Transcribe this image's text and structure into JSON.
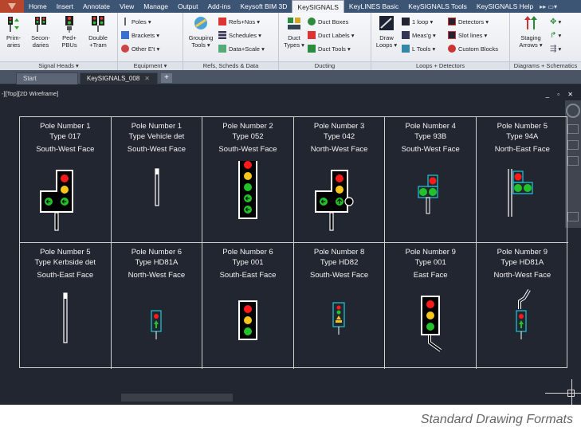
{
  "menubar": {
    "tabs": [
      "Home",
      "Insert",
      "Annotate",
      "View",
      "Manage",
      "Output",
      "Add-ins",
      "Keysoft BIM 3D",
      "KeySIGNALS",
      "KeyLINES Basic",
      "KeySIGNALS Tools",
      "KeySIGNALS Help"
    ],
    "active_tab": "KeySIGNALS"
  },
  "ribbon": {
    "signal_heads": {
      "label": "Signal Heads",
      "buttons": [
        {
          "line1": "Prim-",
          "line2": "aries"
        },
        {
          "line1": "Secon-",
          "line2": "daries"
        },
        {
          "line1": "Ped+",
          "line2": "PBUs"
        },
        {
          "line1": "Double",
          "line2": "+Tram"
        }
      ]
    },
    "equipment": {
      "label": "Equipment",
      "buttons": [
        "Poles",
        "Brackets",
        "Other E't"
      ]
    },
    "refs": {
      "label": "Refs, Scheds & Data",
      "big": {
        "line1": "Grouping",
        "line2": "Tools"
      },
      "buttons": [
        "Refs+Nos",
        "Schedules",
        "Data+Scale"
      ]
    },
    "ducting": {
      "label": "Ducting",
      "big": {
        "line1": "Duct",
        "line2": "Types"
      },
      "buttons": [
        "Duct Boxes",
        "Duct Labels",
        "Duct Tools"
      ]
    },
    "loops": {
      "label": "Loops + Detectors",
      "big": {
        "line1": "Draw",
        "line2": "Loops"
      },
      "buttons": [
        "1 loop",
        "Meas'g",
        "L Tools",
        "Detectors",
        "Slot lines",
        "Custom Blocks"
      ]
    },
    "diagrams": {
      "label": "Diagrams + Schematics",
      "big": {
        "line1": "Staging",
        "line2": "Arrows"
      }
    }
  },
  "doctabs": {
    "start": "Start",
    "active": "KeySIGNALS_008"
  },
  "viewport": {
    "label": "-][Top][2D Wireframe]",
    "cards": [
      {
        "t1": "Pole Number 1",
        "t2": "Type 017",
        "t3": "South-West Face",
        "symbol": "t-head-3"
      },
      {
        "t1": "Pole Number 1",
        "t2": "Type Vehicle det",
        "t3": "South-West Face",
        "symbol": "vehicle-det"
      },
      {
        "t1": "Pole Number 2",
        "t2": "Type 052",
        "t3": "South-West Face",
        "symbol": "tall-5"
      },
      {
        "t1": "Pole Number 3",
        "t2": "Type 042",
        "t3": "North-West Face",
        "symbol": "t-head-3b"
      },
      {
        "t1": "Pole Number 4",
        "t2": "Type 93B",
        "t3": "South-West Face",
        "symbol": "ped-93b"
      },
      {
        "t1": "Pole Number 5",
        "t2": "Type 94A",
        "t3": "North-East Face",
        "symbol": "ped-94a"
      },
      {
        "t1": "Pole Number 5",
        "t2": "Type Kerbside det",
        "t3": "South-East Face",
        "symbol": "kerbside-det"
      },
      {
        "t1": "Pole Number 6",
        "t2": "Type HD81A",
        "t3": "North-West Face",
        "symbol": "hd81a"
      },
      {
        "t1": "Pole Number 6",
        "t2": "Type 001",
        "t3": "South-East Face",
        "symbol": "std-3"
      },
      {
        "t1": "Pole Number 8",
        "t2": "Type HD82",
        "t3": "South-West Face",
        "symbol": "hd82"
      },
      {
        "t1": "Pole Number 9",
        "t2": "Type 001",
        "t3": "East Face",
        "symbol": "std-3-bent"
      },
      {
        "t1": "Pole Number 9",
        "t2": "Type HD81A",
        "t3": "North-West Face",
        "symbol": "hd81a-bent"
      }
    ]
  },
  "footer": {
    "caption": "Standard Drawing Formats"
  }
}
